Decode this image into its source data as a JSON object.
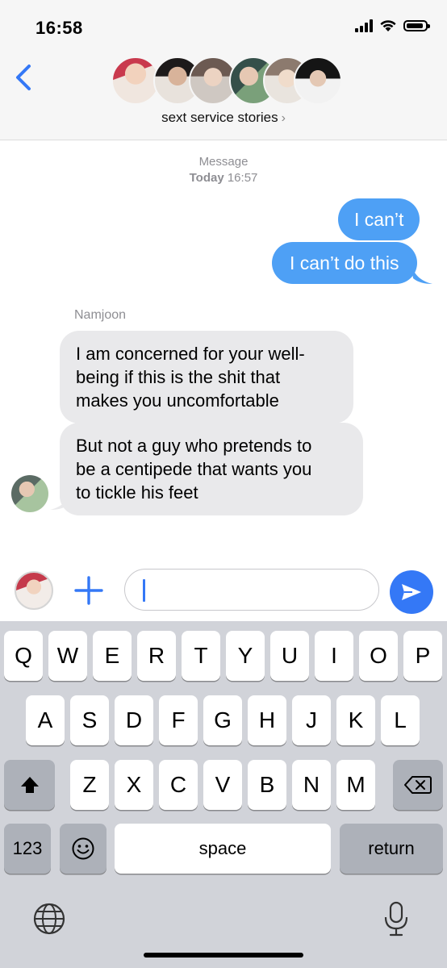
{
  "status_bar": {
    "time": "16:58"
  },
  "header": {
    "group_name": "sext service stories",
    "chevron": "›",
    "participant_count": 6
  },
  "conversation": {
    "service_label": "Message",
    "date_day": "Today",
    "date_time": "16:57",
    "sent": [
      "I can’t",
      "I can’t do this"
    ],
    "sender_name": "Namjoon",
    "received": [
      "I am concerned for your well-being if this is the shit that makes you uncomfortable",
      "But not a guy who pretends to be a centipede that wants you to tickle his feet"
    ],
    "received_lines": [
      [
        "I am concerned for your well-",
        "being if this is the shit that",
        "makes you uncomfortable"
      ],
      [
        "But not a guy who pretends to",
        "be a centipede that wants you",
        "to tickle his feet"
      ]
    ]
  },
  "input_bar": {
    "value": ""
  },
  "keyboard": {
    "row1": [
      "Q",
      "W",
      "E",
      "R",
      "T",
      "Y",
      "U",
      "I",
      "O",
      "P"
    ],
    "row2": [
      "A",
      "S",
      "D",
      "F",
      "G",
      "H",
      "J",
      "K",
      "L"
    ],
    "row3": [
      "Z",
      "X",
      "C",
      "V",
      "B",
      "N",
      "M"
    ],
    "numbers_key": "123",
    "space_key": "space",
    "return_key": "return"
  },
  "colors": {
    "sent_bubble": "#4ea0f5",
    "received_bubble": "#e9e9eb",
    "accent": "#3478f6",
    "keyboard_bg": "#d1d3d9"
  },
  "icons": [
    "back-chevron-icon",
    "signal-icon",
    "wifi-icon",
    "battery-icon",
    "plus-icon",
    "send-arrow-icon",
    "shift-icon",
    "backspace-icon",
    "emoji-icon",
    "globe-icon",
    "microphone-icon"
  ]
}
